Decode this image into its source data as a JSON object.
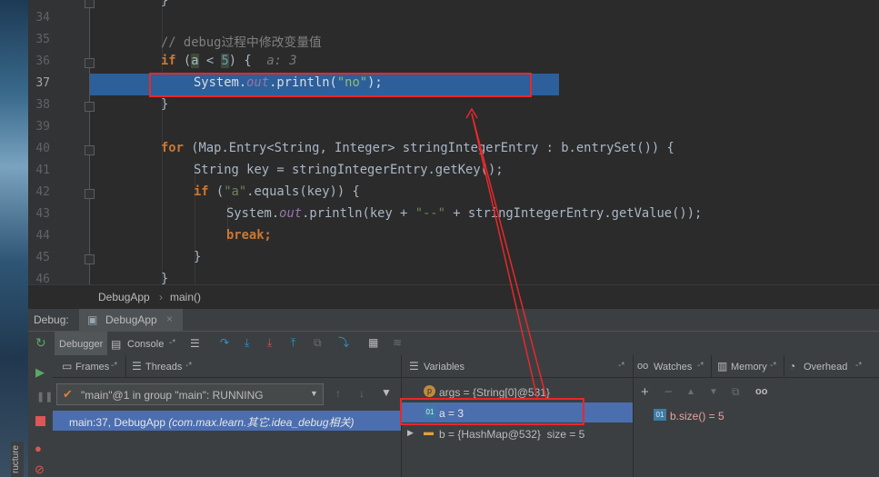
{
  "editor": {
    "line_numbers": [
      "34",
      "35",
      "36",
      "37",
      "38",
      "39",
      "40",
      "41",
      "42",
      "43",
      "44",
      "45",
      "46"
    ],
    "code": {
      "l35_comment": "// debug过程中修改变量值",
      "l36_if": "if",
      "l36_open": " (",
      "l36_a": "a",
      "l36_lt": " < ",
      "l36_five": "5",
      "l36_close": ") {",
      "l36_hint": "a: 3",
      "l37_system": "System.",
      "l37_out": "out",
      "l37_println": ".println(",
      "l37_str": "\"no\"",
      "l37_end": ");",
      "l38": "}",
      "l40_for": "for",
      "l40_rest": " (Map.Entry<String, Integer> stringIntegerEntry : b.entrySet()) {",
      "l41": "String key = stringIntegerEntry.getKey();",
      "l42_if": "if",
      "l42_open": " (",
      "l42_str": "\"a\"",
      "l42_rest": ".equals(key)) {",
      "l43_system": "System.",
      "l43_out": "out",
      "l43_mid": ".println(key + ",
      "l43_str": "\"--\"",
      "l43_rest": " + stringIntegerEntry.getValue());",
      "l44_break": "break;",
      "l45": "}",
      "l46": "}"
    },
    "breadcrumb": [
      "DebugApp",
      "main()"
    ]
  },
  "debug_panel": {
    "label": "Debug:",
    "session_tab": "DebugApp",
    "tabs": [
      "Debugger",
      "Console"
    ],
    "frames_tab": "Frames",
    "threads_tab": "Threads",
    "thread_select": "\"main\"@1 in group \"main\": RUNNING",
    "frame_item_main": "main:37, DebugApp",
    "frame_item_pkg": "(com.max.learn.其它.idea_debug相关)",
    "variables_title": "Variables",
    "variables": [
      {
        "icon": "p",
        "text": "args = {String[0]@531}"
      },
      {
        "icon": "01",
        "text": "a = 3"
      },
      {
        "icon": "▬",
        "text": "b = {HashMap@532}  size = 5"
      }
    ],
    "right_tabs": [
      "Watches",
      "Memory",
      "Overhead"
    ],
    "watch_item": "b.size() = 5",
    "side_tab": "ructure"
  },
  "colors": {
    "accent_selection": "#4b6eaf",
    "exec_line": "#2d5f9a",
    "annotation_red": "#e8282a"
  }
}
